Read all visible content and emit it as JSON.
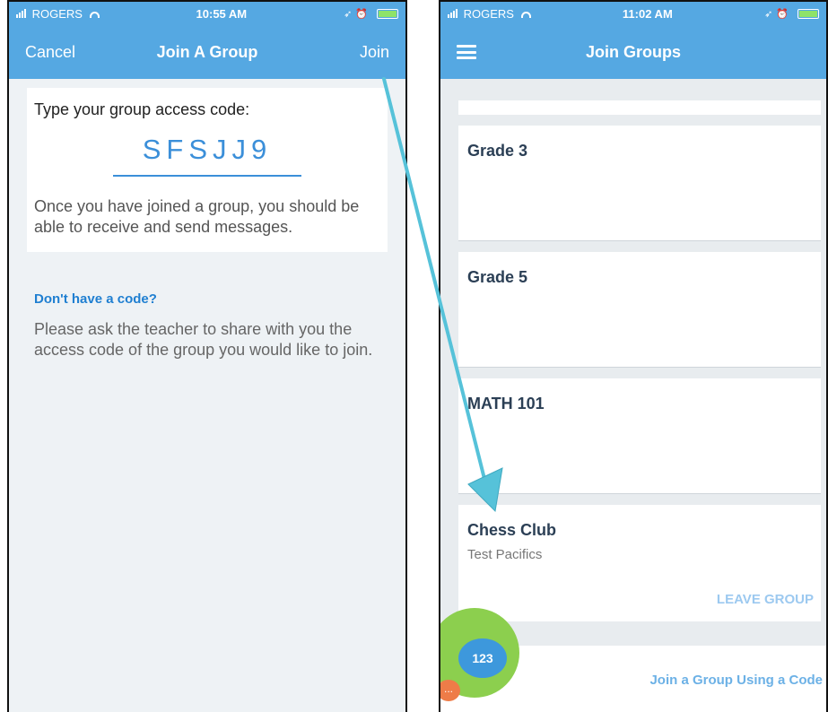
{
  "left_screen": {
    "status": {
      "carrier": "ROGERS",
      "time": "10:55 AM"
    },
    "nav": {
      "cancel": "Cancel",
      "title": "Join A Group",
      "join": "Join"
    },
    "code_prompt": "Type your group access code:",
    "code_value": "SFSJJ9",
    "help_text": "Once you have joined a group, you should be able to receive and send messages.",
    "no_code_heading": "Don't have a code?",
    "no_code_text": "Please ask the teacher to share with you the access code of the group you would like to join."
  },
  "right_screen": {
    "status": {
      "carrier": "ROGERS",
      "time": "11:02 AM"
    },
    "nav": {
      "title": "Join Groups"
    },
    "groups": [
      {
        "name": "Grade 3"
      },
      {
        "name": "Grade 5"
      },
      {
        "name": "MATH 101"
      },
      {
        "name": "Chess Club",
        "subtitle": "Test Pacifics",
        "action": "LEAVE GROUP"
      }
    ],
    "fab_label": "123",
    "fab_small": "...",
    "join_code_link": "Join a Group Using a Code"
  },
  "colors": {
    "header": "#55a8e2",
    "accent": "#3b8fd9",
    "arrow": "#56c2d9",
    "fab_green": "#8ccf4e"
  }
}
